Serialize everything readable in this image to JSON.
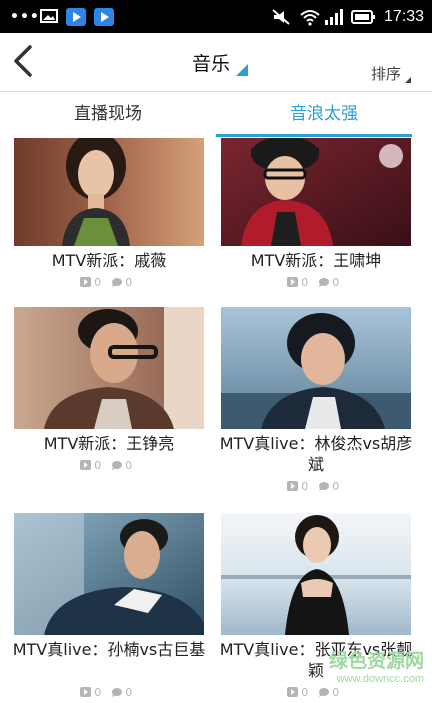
{
  "status_bar": {
    "dots": "•••",
    "time": "17:33",
    "icons": [
      "image-icon",
      "player-icon",
      "player-icon",
      "mute-icon",
      "wifi-icon",
      "signal-icon",
      "battery-icon"
    ]
  },
  "header": {
    "title": "音乐",
    "sort_label": "排序",
    "accent": "#2aa0d4"
  },
  "tabs": [
    {
      "label": "直播现场",
      "active": false
    },
    {
      "label": "音浪太强",
      "active": true
    }
  ],
  "cards": [
    {
      "title": "MTV新派：戚薇",
      "views": "0",
      "comments": "0"
    },
    {
      "title": "MTV新派：王啸坤",
      "views": "0",
      "comments": "0"
    },
    {
      "title": "MTV新派：王铮亮",
      "views": "0",
      "comments": "0"
    },
    {
      "title": "MTV真live：林俊杰vs胡彦斌",
      "views": "0",
      "comments": "0"
    },
    {
      "title": "MTV真live：孙楠vs古巨基",
      "views": "0",
      "comments": "0"
    },
    {
      "title": "MTV真live：张亚东vs张靓颖",
      "views": "0",
      "comments": "0"
    }
  ],
  "watermark": {
    "main": "绿色资源网",
    "url": "www.downcc.com"
  }
}
